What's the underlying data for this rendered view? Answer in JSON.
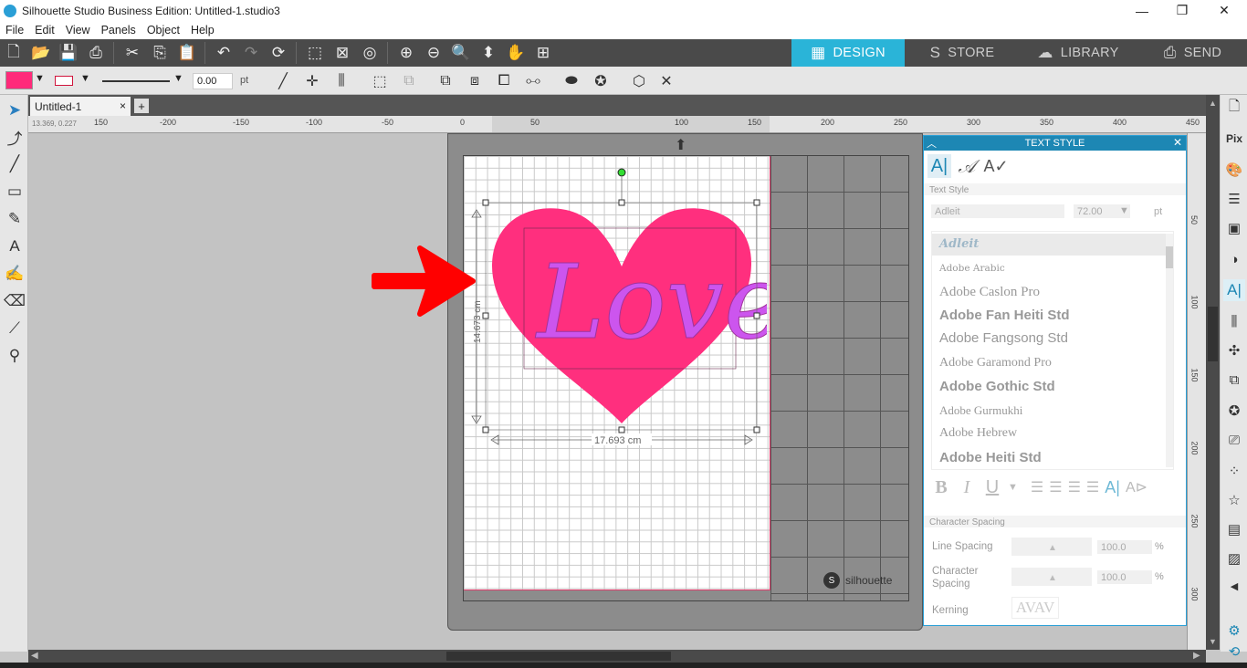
{
  "window": {
    "title": "Silhouette Studio Business Edition: Untitled-1.studio3",
    "min": "—",
    "max": "❐",
    "close": "✕"
  },
  "menu": [
    "File",
    "Edit",
    "View",
    "Panels",
    "Object",
    "Help"
  ],
  "tabs": [
    {
      "label": "DESIGN",
      "icon": "▦",
      "active": true
    },
    {
      "label": "STORE",
      "icon": "S",
      "active": false
    },
    {
      "label": "LIBRARY",
      "icon": "☁",
      "active": false
    },
    {
      "label": "SEND",
      "icon": "⎙",
      "active": false
    }
  ],
  "toolbar2": {
    "line_width": "0.00",
    "line_unit": "pt",
    "fill_color": "#ff2a7a",
    "line_color": "#d0143c"
  },
  "doc_tab": {
    "name": "Untitled-1",
    "close": "×",
    "add": "+"
  },
  "ruler": {
    "coords": "13.369, 0.227",
    "h_labels": [
      "150",
      "-200",
      "-150",
      "-100",
      "-50",
      "0",
      "50",
      "100",
      "150",
      "200",
      "250",
      "300",
      "350",
      "400",
      "450"
    ],
    "v_labels": [
      "50",
      "100",
      "150",
      "200",
      "250",
      "300"
    ]
  },
  "canvas": {
    "heart_color": "#ff2f7e",
    "text": "Love",
    "text_color": "#cc55ee",
    "height_dim": "14.673 cm",
    "width_dim": "17.693 cm",
    "brand": "silhouette",
    "arrow_color": "#ff0000"
  },
  "text_style": {
    "title": "TEXT STYLE",
    "section": "Text Style",
    "font_name": "Adleit",
    "font_size": "72.00",
    "size_unit": "pt",
    "fonts": [
      "Adleit",
      "Adobe Arabic",
      "Adobe Caslon Pro",
      "Adobe Fan Heiti Std",
      "Adobe Fangsong Std",
      "Adobe Garamond Pro",
      "Adobe Gothic Std",
      "Adobe Gurmukhi",
      "Adobe Hebrew",
      "Adobe Heiti Std"
    ],
    "format_buttons": {
      "bold": "B",
      "italic": "I",
      "underline": "U"
    },
    "spacing_section": "Character Spacing",
    "line_spacing_label": "Line Spacing",
    "line_spacing_value": "100.0",
    "char_spacing_label": "Character Spacing",
    "char_spacing_value": "100.0",
    "percent": "%",
    "kerning_label": "Kerning",
    "kerning_glyph": "AVAV"
  }
}
